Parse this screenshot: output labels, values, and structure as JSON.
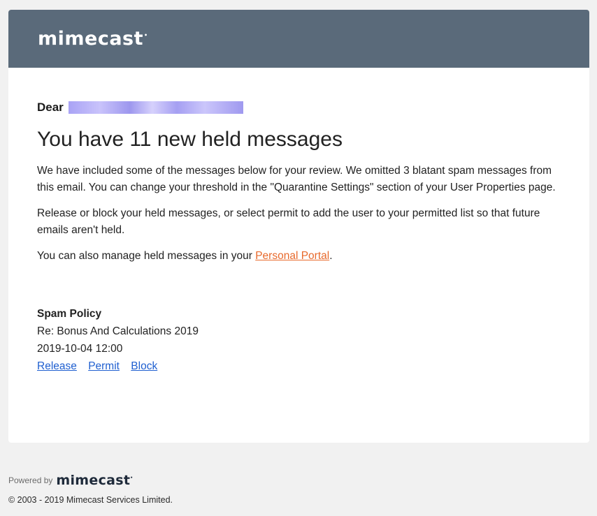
{
  "header": {
    "logo_text": "mimecast",
    "logo_mark": "•"
  },
  "greeting": {
    "salutation": "Dear"
  },
  "main": {
    "heading": "You have 11 new held messages",
    "paragraph1": "We have included some of the messages below for your review. We omitted 3 blatant spam messages from this email. You can change your threshold in the \"Quarantine Settings\" section of your User Properties page.",
    "paragraph2": "Release or block your held messages, or select permit to add the user to your permitted list so that future emails aren't held.",
    "paragraph3_prefix": "You can also manage held messages in your ",
    "portal_link": "Personal Portal",
    "paragraph3_suffix": "."
  },
  "message": {
    "policy": "Spam Policy",
    "subject": "Re: Bonus And Calculations 2019",
    "date": "2019-10-04 12:00",
    "actions": {
      "release": "Release",
      "permit": "Permit",
      "block": "Block"
    }
  },
  "footer": {
    "powered_by": "Powered by",
    "logo_text": "mimecast",
    "logo_mark": "•",
    "copyright": "© 2003 - 2019 Mimecast Services Limited."
  },
  "colors": {
    "header_bg": "#5a6a7a",
    "link": "#1f5fd0",
    "portal_link": "#e8692b",
    "page_bg": "#f1f1f1"
  }
}
